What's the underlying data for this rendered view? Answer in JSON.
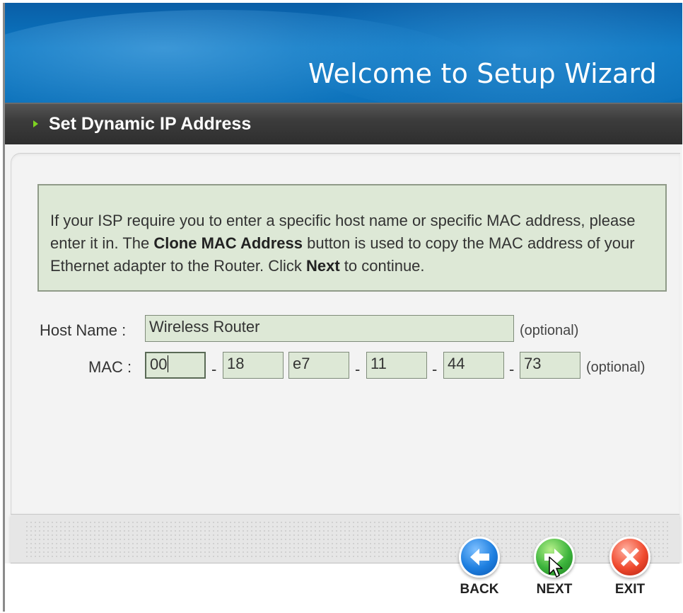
{
  "banner": {
    "title": "Welcome to Setup Wizard"
  },
  "section": {
    "title": "Set Dynamic IP Address"
  },
  "info": {
    "part1": "If your ISP require you to enter a specific host name or specific MAC address, please enter it in. The ",
    "bold1": "Clone MAC Address",
    "part2": " button is used to copy the MAC address of your Ethernet adapter to the Router. Click ",
    "bold2": "Next",
    "part3": " to continue."
  },
  "form": {
    "host_label": "Host Name :",
    "host_value": "Wireless Router",
    "mac_label": "MAC :",
    "mac_values": [
      "00",
      "18",
      "e7",
      "11",
      "44",
      "73"
    ],
    "separator": "-",
    "optional": "(optional)"
  },
  "buttons": {
    "back": "BACK",
    "next": "NEXT",
    "exit": "EXIT"
  },
  "icons": {
    "back": "arrow-left-icon",
    "next": "arrow-right-icon",
    "exit": "close-x-icon",
    "section": "triangle-right-icon"
  },
  "colors": {
    "banner_blue": "#0b77c2",
    "section_bar": "#3c3c3c",
    "field_bg": "#dde8d6",
    "accent_green": "#7ed321"
  }
}
